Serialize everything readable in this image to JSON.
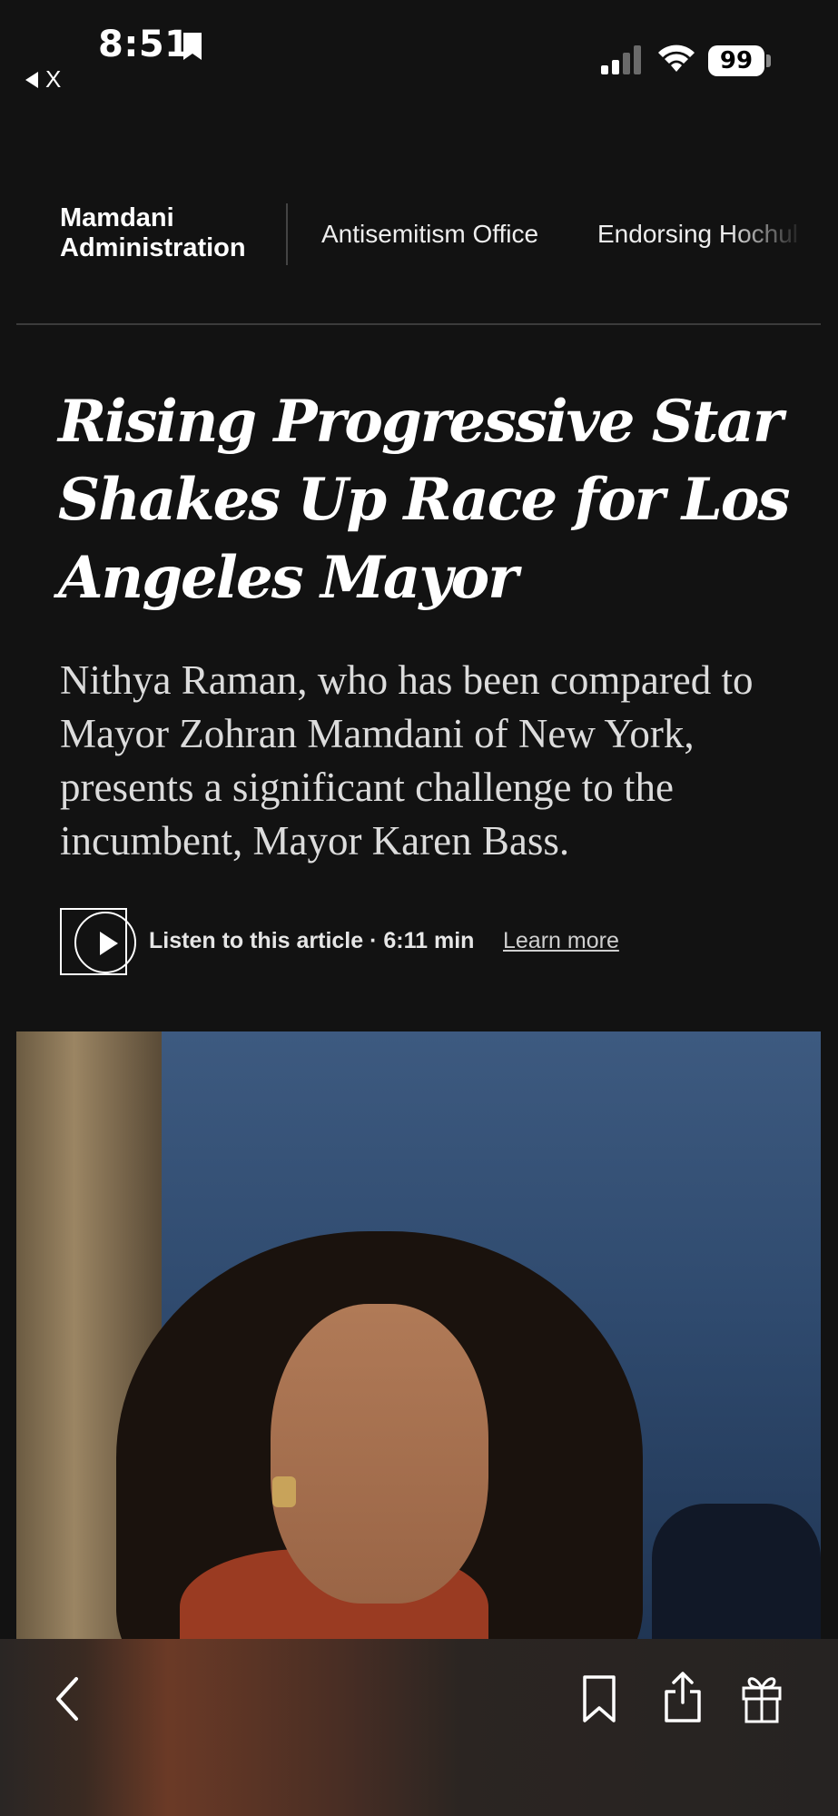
{
  "status_bar": {
    "time": "8:51",
    "back_app_label": "X",
    "battery": "99"
  },
  "topic_nav": {
    "section_label": "Mamdani Administration",
    "topics": [
      "Antisemitism Office",
      "Endorsing Hochul"
    ]
  },
  "article": {
    "headline": "Rising Progressive Star Shakes Up Race for Los Angeles Mayor",
    "summary": "Nithya Raman, who has been compared to Mayor Zohran Mamdani of New York, presents a significant challenge to the incumbent, Mayor Karen Bass.",
    "audio": {
      "listen_label": "Listen to this article · 6:11 min",
      "learn_more": "Learn more"
    }
  },
  "icons": {
    "back": "chevron-left-icon",
    "save": "bookmark-icon",
    "share": "share-icon",
    "gift": "gift-icon",
    "play": "play-icon"
  },
  "colors": {
    "background": "#121212",
    "text": "#ffffff",
    "summary_text": "#dcdcdc",
    "divider": "#3b3b3b"
  }
}
